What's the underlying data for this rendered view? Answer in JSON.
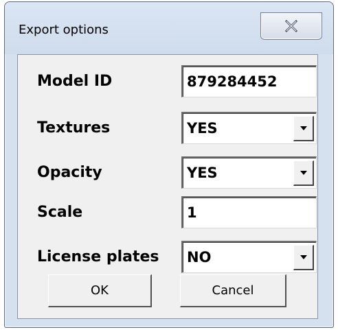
{
  "window": {
    "title": "Export options",
    "close_icon": "close-icon"
  },
  "form": {
    "model_id": {
      "label": "Model ID",
      "value": "879284452"
    },
    "textures": {
      "label": "Textures",
      "value": "YES"
    },
    "opacity": {
      "label": "Opacity",
      "value": "YES"
    },
    "scale": {
      "label": "Scale",
      "value": "1"
    },
    "license_plates": {
      "label": "License plates",
      "value": "NO"
    }
  },
  "buttons": {
    "ok_label": "OK",
    "cancel_label": "Cancel"
  },
  "colors": {
    "frame": "#d6e1ef",
    "client_bg": "#f0f0f0",
    "field_bg": "#ffffff"
  }
}
